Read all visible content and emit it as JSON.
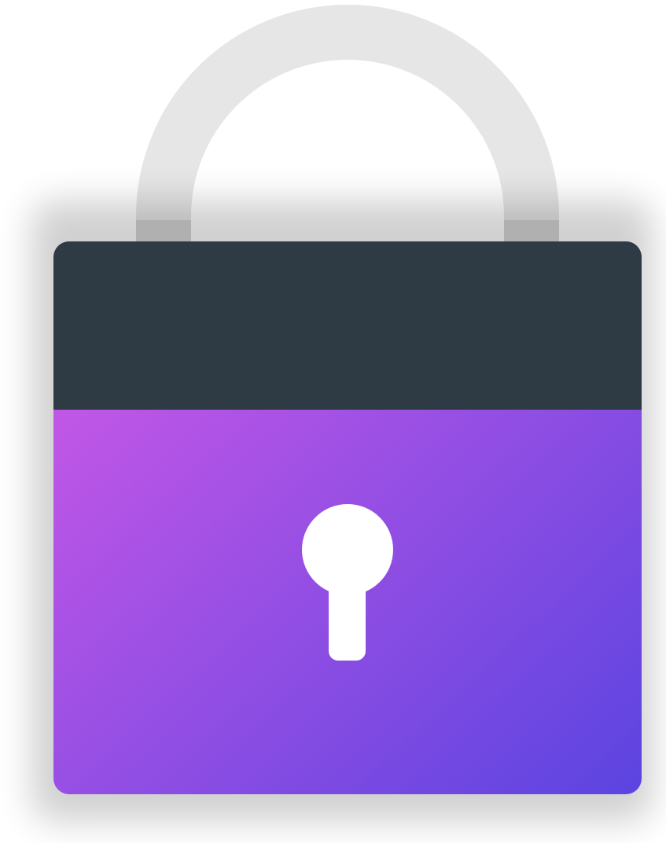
{
  "icon": {
    "name": "padlock-icon",
    "colors": {
      "background": "#ffffff",
      "shackle": "#e6e6e6",
      "body_top": "#2e3a44",
      "gradient_start": "#d45ae8",
      "gradient_end": "#5b44e0",
      "keyhole": "#ffffff"
    }
  }
}
